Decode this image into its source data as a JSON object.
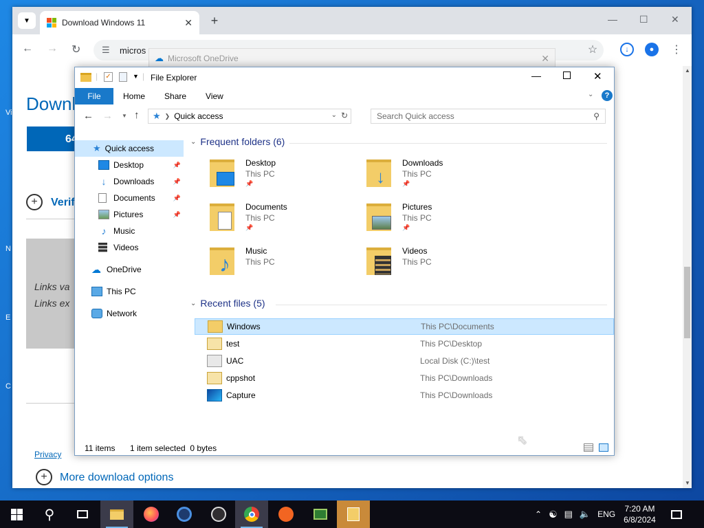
{
  "desktop": {
    "side_text": [
      "Vi",
      "N",
      "E",
      "C"
    ]
  },
  "browser": {
    "tab_title": "Download Windows 11",
    "url_text": "micros",
    "page": {
      "title": "Downl",
      "download_button": "64",
      "verify_text": "Verify",
      "links_line1": "Links va",
      "links_line2": "Links ex",
      "privacy": "Privacy",
      "more_options": "More download options"
    }
  },
  "onedrive": {
    "title": "Microsoft OneDrive"
  },
  "explorer": {
    "title": "File Explorer",
    "ribbon_tabs": [
      "File",
      "Home",
      "Share",
      "View"
    ],
    "path": "Quick access",
    "search_placeholder": "Search Quick access",
    "sidebar": [
      {
        "label": "Quick access",
        "icon": "star-icon"
      },
      {
        "label": "Desktop",
        "icon": "desktop-icon",
        "pinned": true
      },
      {
        "label": "Downloads",
        "icon": "download-icon",
        "pinned": true
      },
      {
        "label": "Documents",
        "icon": "documents-icon",
        "pinned": true
      },
      {
        "label": "Pictures",
        "icon": "pictures-icon",
        "pinned": true
      },
      {
        "label": "Music",
        "icon": "music-icon"
      },
      {
        "label": "Videos",
        "icon": "videos-icon"
      },
      {
        "label": "OneDrive",
        "icon": "cloud-icon"
      },
      {
        "label": "This PC",
        "icon": "pc-icon"
      },
      {
        "label": "Network",
        "icon": "network-icon"
      }
    ],
    "frequent_header": "Frequent folders (6)",
    "frequent": [
      {
        "name": "Desktop",
        "location": "This PC"
      },
      {
        "name": "Downloads",
        "location": "This PC"
      },
      {
        "name": "Documents",
        "location": "This PC"
      },
      {
        "name": "Pictures",
        "location": "This PC"
      },
      {
        "name": "Music",
        "location": "This PC"
      },
      {
        "name": "Videos",
        "location": "This PC"
      }
    ],
    "recent_header": "Recent files (5)",
    "recent": [
      {
        "name": "Windows",
        "path": "This PC\\Documents"
      },
      {
        "name": "test",
        "path": "This PC\\Desktop"
      },
      {
        "name": "UAC",
        "path": "Local Disk (C:)\\test"
      },
      {
        "name": "cppshot",
        "path": "This PC\\Downloads"
      },
      {
        "name": "Capture",
        "path": "This PC\\Downloads"
      }
    ],
    "status_items": "11 items",
    "status_selected": "1 item selected  0 bytes"
  },
  "taskbar": {
    "language": "ENG",
    "time": "7:20 AM",
    "date": "6/8/2024"
  },
  "colors": {
    "accent": "#0067b8",
    "ribbon_file": "#1979ca",
    "selection": "#cce8ff",
    "section_header": "#1e3287"
  }
}
